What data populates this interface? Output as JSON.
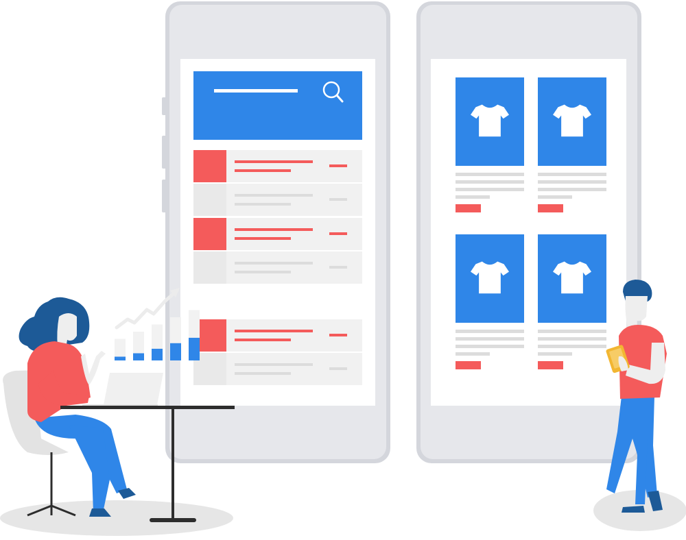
{
  "colors": {
    "phone_body": "#e6e7eb",
    "phone_edge": "#d4d6dc",
    "screen": "#ffffff",
    "accent_blue": "#2f86e8",
    "accent_red": "#f45b5b",
    "row_bg": "#f1f1f1",
    "row_tile": "#e9e9e9",
    "placeholder_line": "#dcdcdc",
    "skin": "#eeeeee",
    "hair": "#1d5a97",
    "shirt": "#f45b5b",
    "pants": "#2f86e8",
    "chair": "#e3e3e3",
    "shadow": "#e6e6e6",
    "tablet": "#f2b632",
    "dark": "#2d2d2d"
  },
  "icons": [
    "search-icon",
    "tshirt-icon",
    "trend-line-icon",
    "bar-chart-icon"
  ],
  "left_phone": {
    "list_rows": [
      {
        "highlighted": true
      },
      {
        "highlighted": false
      },
      {
        "highlighted": true
      },
      {
        "highlighted": false
      },
      {
        "highlighted": true
      },
      {
        "highlighted": false
      }
    ]
  },
  "right_phone": {
    "product_cards": [
      {
        "icon": "tshirt-icon"
      },
      {
        "icon": "tshirt-icon"
      },
      {
        "icon": "tshirt-icon"
      },
      {
        "icon": "tshirt-icon"
      }
    ]
  },
  "woman_chart": {
    "bar_levels": [
      0.35,
      0.5,
      0.65,
      0.8,
      0.9
    ]
  }
}
